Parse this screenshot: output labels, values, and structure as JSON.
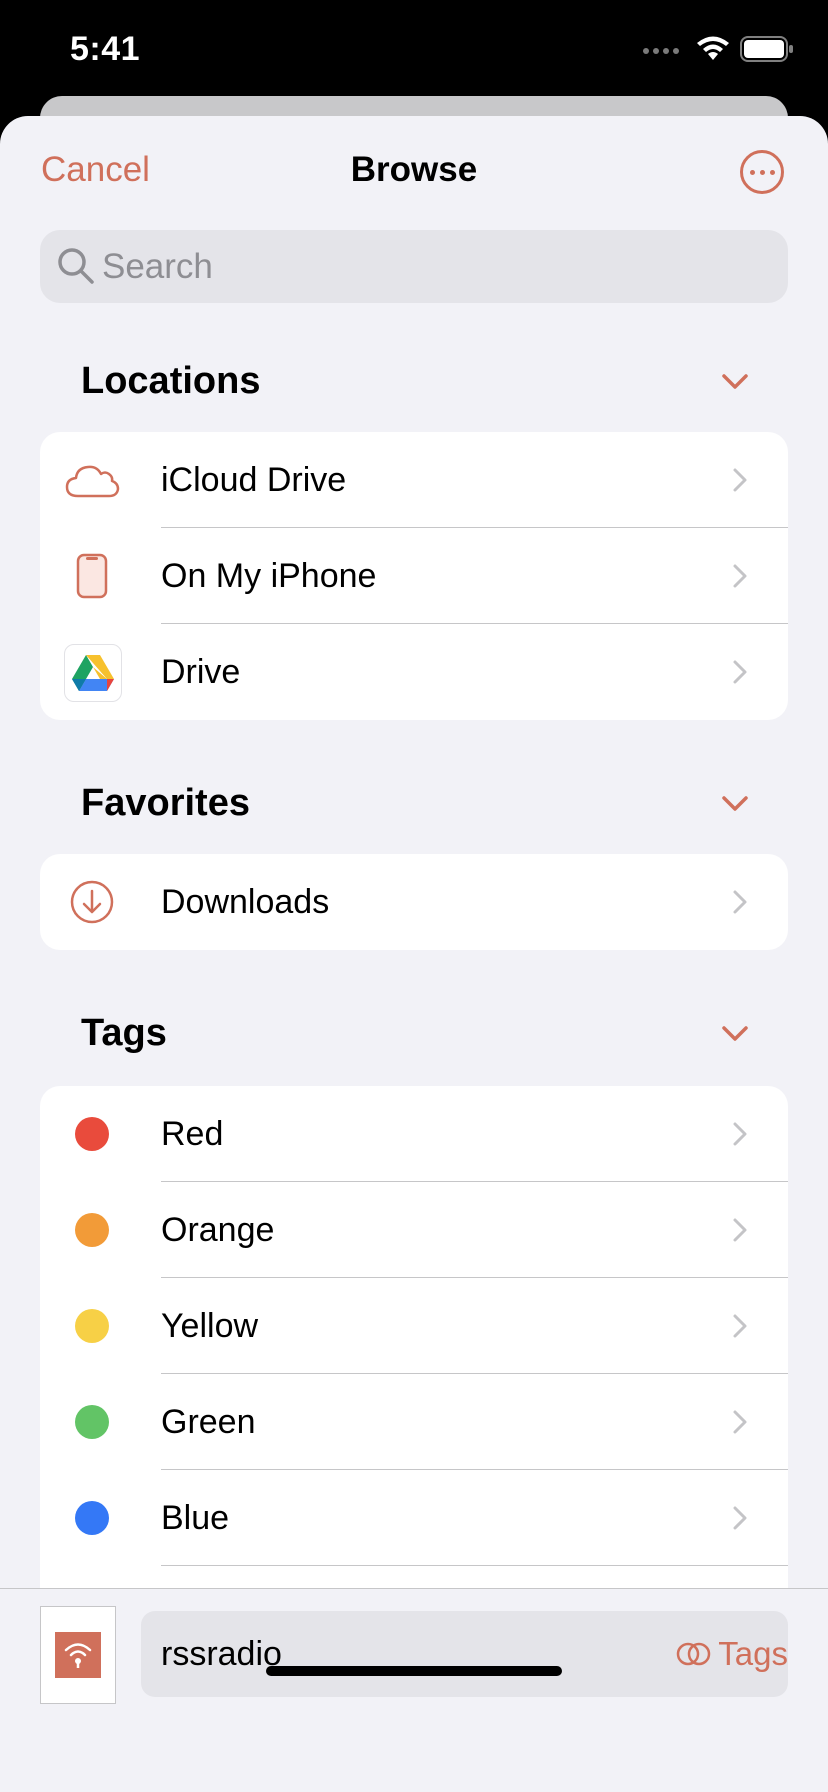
{
  "status_bar": {
    "time": "5:41",
    "icons": [
      "cellular-icon",
      "wifi-icon",
      "battery-icon"
    ]
  },
  "nav": {
    "cancel_label": "Cancel",
    "title": "Browse",
    "more_icon": "ellipsis-circle-icon"
  },
  "search": {
    "placeholder": "Search",
    "value": ""
  },
  "locations": {
    "heading": "Locations",
    "items": [
      {
        "label": "iCloud Drive",
        "icon": "cloud-icon"
      },
      {
        "label": "On My iPhone",
        "icon": "iphone-icon"
      },
      {
        "label": "Drive",
        "icon": "google-drive-icon"
      }
    ]
  },
  "favorites": {
    "heading": "Favorites",
    "items": [
      {
        "label": "Downloads",
        "icon": "download-circle-icon"
      }
    ]
  },
  "tags": {
    "heading": "Tags",
    "items": [
      {
        "label": "Red",
        "color": "#e94b3c"
      },
      {
        "label": "Orange",
        "color": "#f29b38"
      },
      {
        "label": "Yellow",
        "color": "#f7d046"
      },
      {
        "label": "Green",
        "color": "#62c466"
      },
      {
        "label": "Blue",
        "color": "#3478f6"
      }
    ]
  },
  "bottom": {
    "filename": "rssradio",
    "tags_label": "Tags",
    "file_icon": "podcast-icon"
  },
  "colors": {
    "accent": "#d0705b",
    "background": "#f2f2f7"
  }
}
